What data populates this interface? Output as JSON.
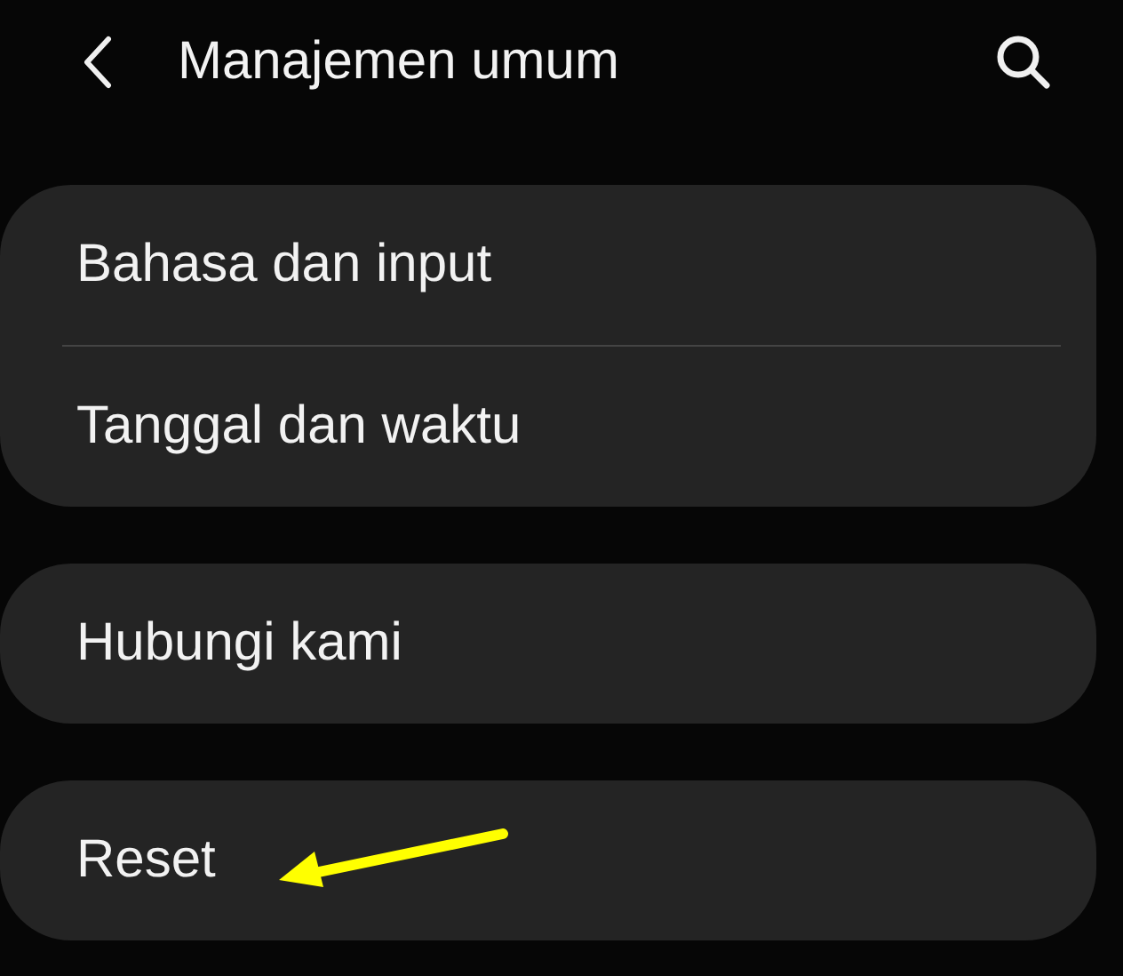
{
  "header": {
    "title": "Manajemen umum"
  },
  "groups": [
    {
      "items": [
        {
          "label": "Bahasa dan input",
          "marked": false
        },
        {
          "label": "Tanggal dan waktu",
          "marked": false
        }
      ]
    },
    {
      "items": [
        {
          "label": "Hubungi kami",
          "marked": false
        }
      ]
    },
    {
      "items": [
        {
          "label": "Reset",
          "marked": true
        }
      ]
    }
  ]
}
